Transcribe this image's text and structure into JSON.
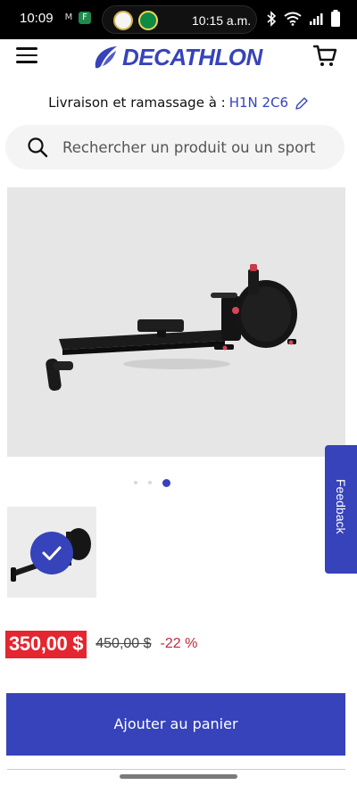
{
  "status_bar": {
    "time": "10:09",
    "pill_time": "10:15 a.m."
  },
  "header": {
    "brand": "DECATHLON"
  },
  "delivery": {
    "label": "Livraison et ramassage à :",
    "postal_code": "H1N 2C6"
  },
  "search": {
    "placeholder": "Rechercher un produit ou un sport"
  },
  "gallery": {
    "dot_count": 3,
    "active_index": 2
  },
  "feedback": {
    "label": "Feedback"
  },
  "price": {
    "current": "350,00 $",
    "original": "450,00 $",
    "discount": "-22 %"
  },
  "actions": {
    "add_to_cart": "Ajouter au panier"
  },
  "colors": {
    "brand": "#3643BA",
    "price_badge": "#E3262F",
    "discount": "#C0293B"
  }
}
